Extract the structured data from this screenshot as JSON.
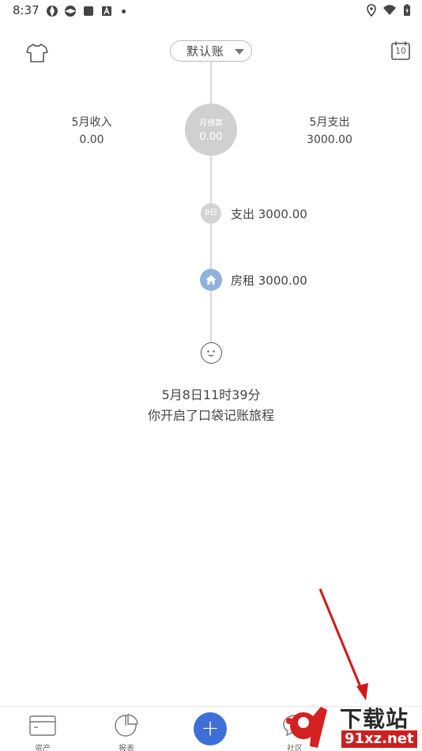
{
  "status_bar": {
    "time": "8:37"
  },
  "header": {
    "ledger": "默认账",
    "calendar_day": "10"
  },
  "summary": {
    "income_label": "5月收入",
    "income_value": "0.00",
    "budget_label": "月预算",
    "budget_value": "0.00",
    "expense_label": "5月支出",
    "expense_value": "3000.00"
  },
  "timeline": {
    "day_badge": "8日",
    "day_summary": "支出 3000.00",
    "entry_text": "房租 3000.00",
    "start_date": "5月8日11时39分",
    "start_text": "你开启了口袋记账旅程"
  },
  "bottom_nav": {
    "assets": "资产",
    "report": "报表",
    "add": "+",
    "community": "社区"
  },
  "watermark": {
    "brand": "下载站",
    "site": "91xz.net"
  },
  "colors": {
    "accent": "#3e6fd8",
    "category": "#8fb3dc",
    "arrow": "#d01818"
  }
}
